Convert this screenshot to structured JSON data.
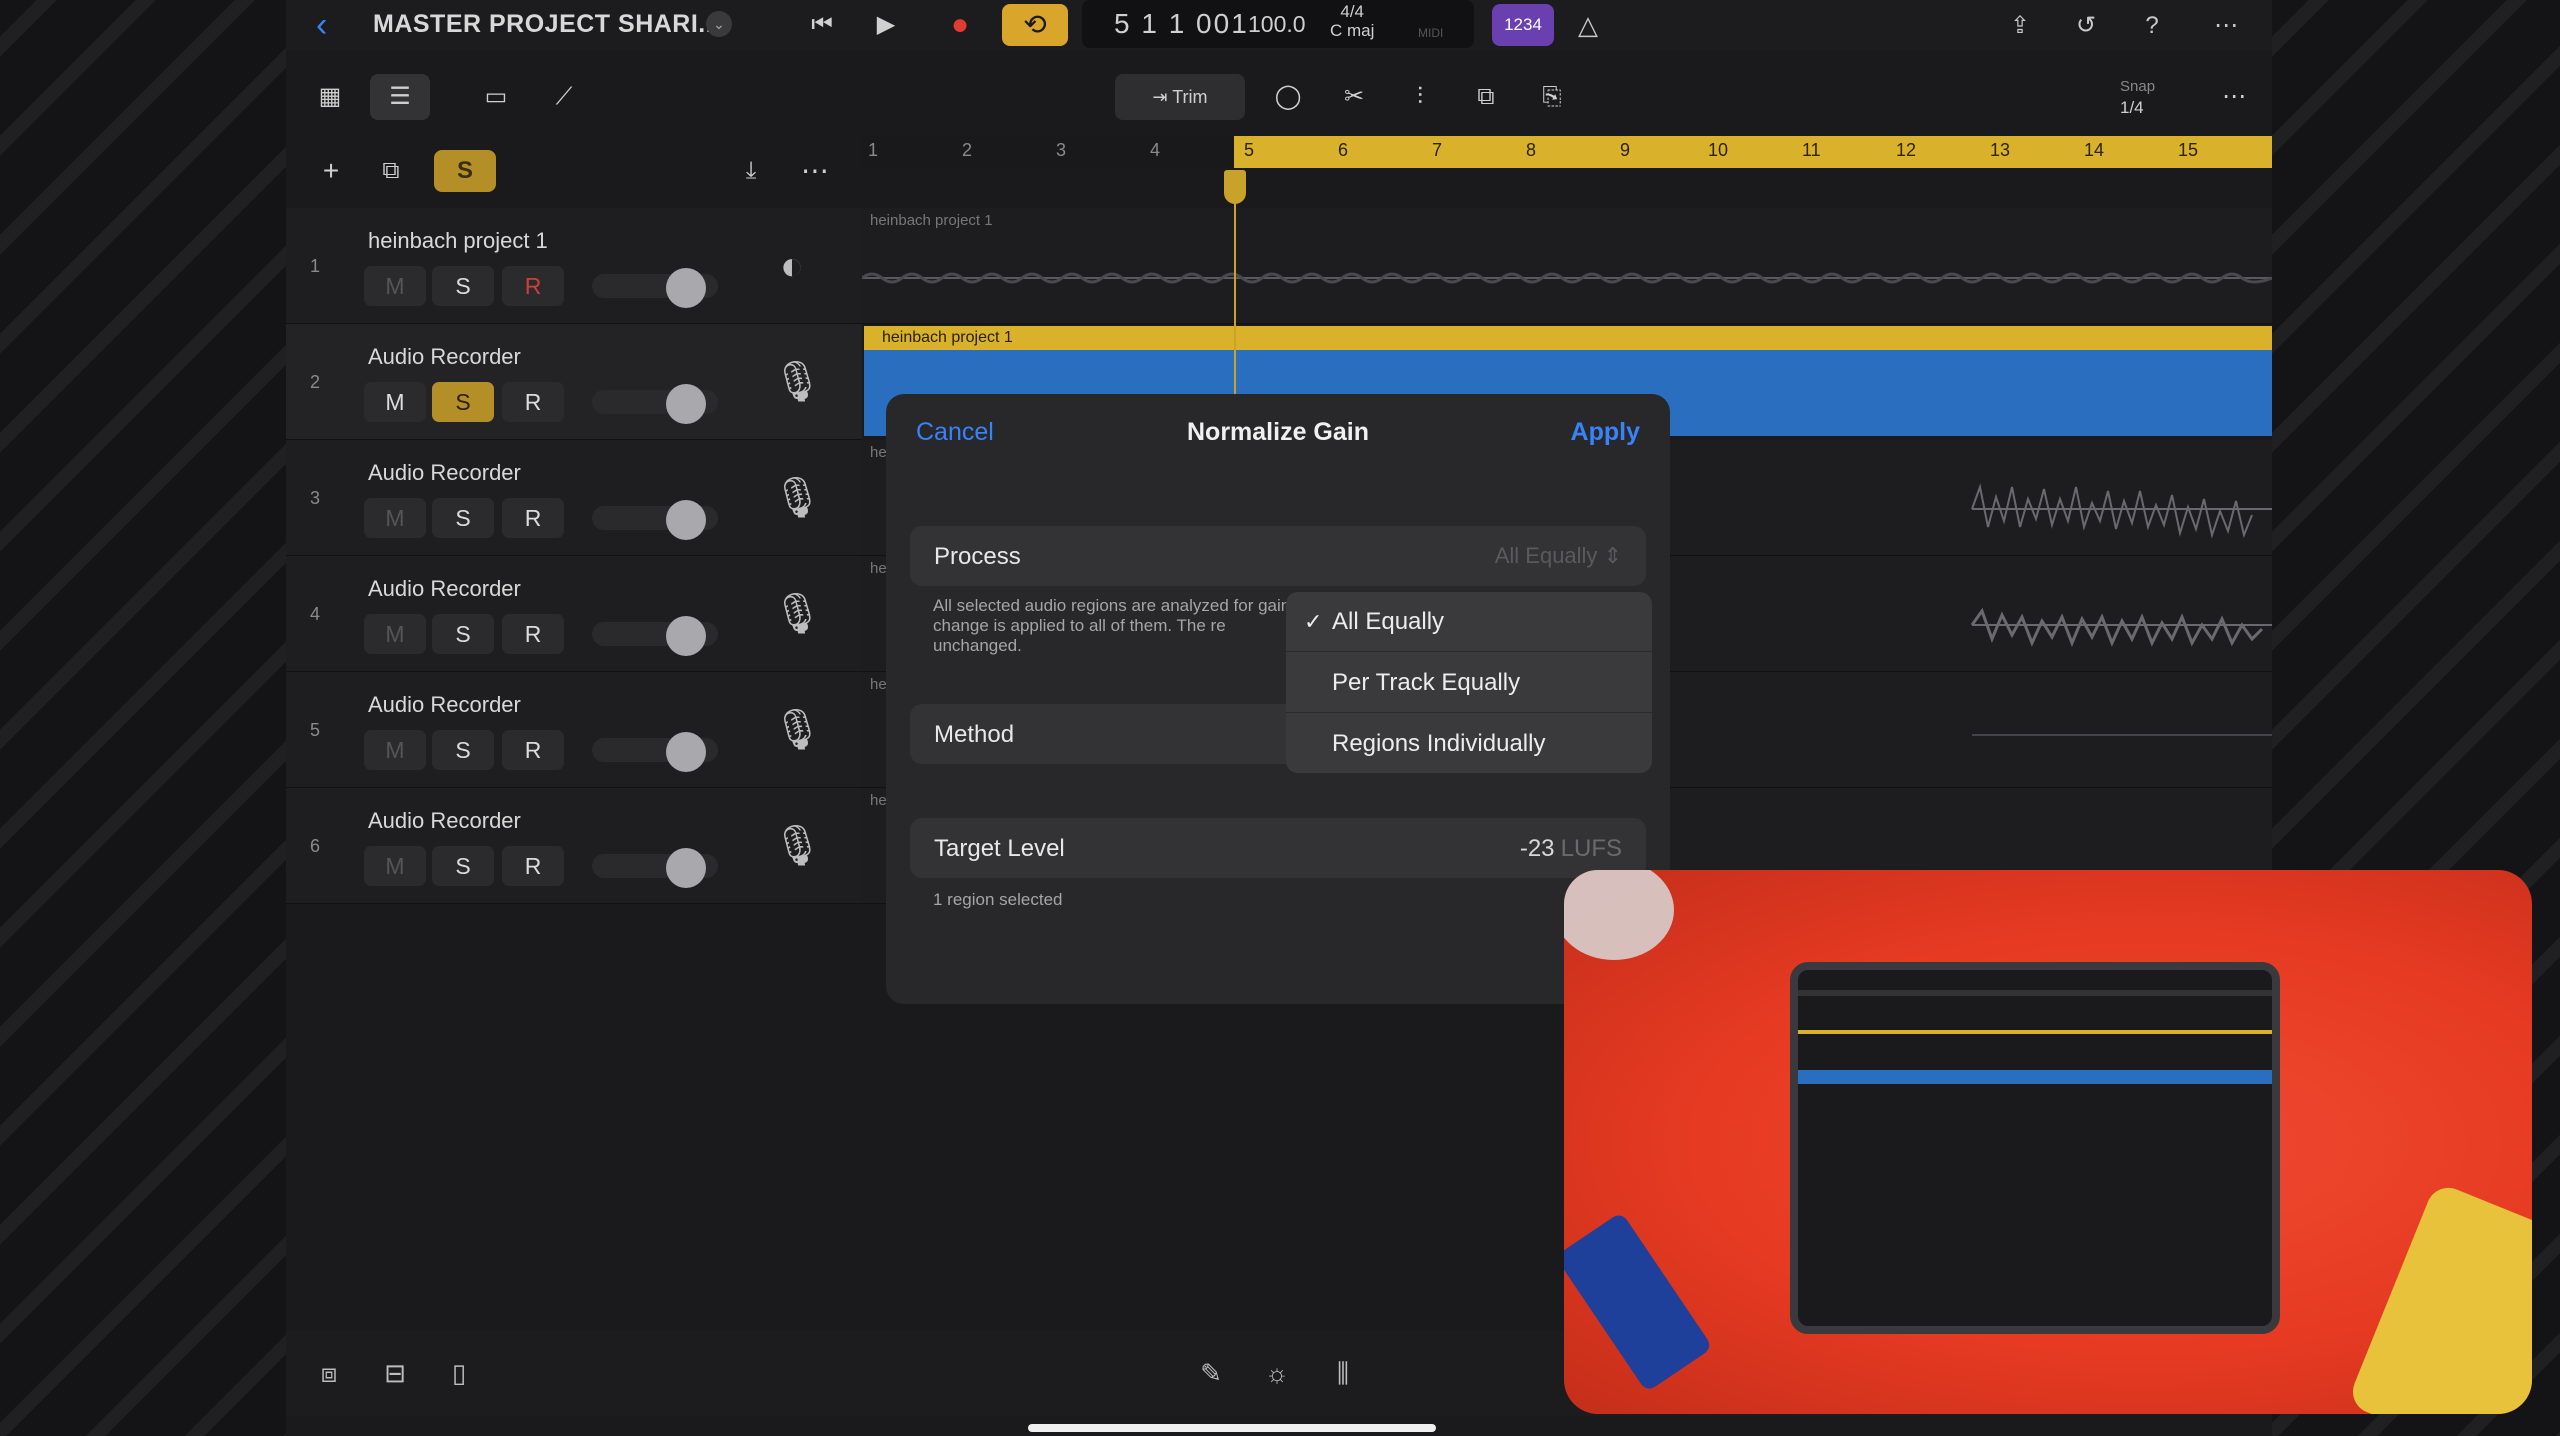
{
  "header": {
    "project_title": "MASTER PROJECT SHARI...",
    "position": "5 1 1 001",
    "tempo": "100.0",
    "time_signature": "4/4",
    "key": "C maj",
    "midi_label": "MIDI",
    "count_in": "1234"
  },
  "toolbar": {
    "trim_label": "Trim",
    "snap_label": "Snap",
    "snap_value": "1/4"
  },
  "track_header": {
    "solo_label": "S"
  },
  "ruler": {
    "bars": [
      "1",
      "2",
      "3",
      "4",
      "5",
      "6",
      "7",
      "8",
      "9",
      "10",
      "11",
      "12",
      "13",
      "14",
      "15"
    ]
  },
  "tracks": [
    {
      "number": "1",
      "name": "heinbach project 1",
      "m": "M",
      "s": "S",
      "r": "R"
    },
    {
      "number": "2",
      "name": "Audio Recorder",
      "m": "M",
      "s": "S",
      "r": "R"
    },
    {
      "number": "3",
      "name": "Audio Recorder",
      "m": "M",
      "s": "S",
      "r": "R"
    },
    {
      "number": "4",
      "name": "Audio Recorder",
      "m": "M",
      "s": "S",
      "r": "R"
    },
    {
      "number": "5",
      "name": "Audio Recorder",
      "m": "M",
      "s": "S",
      "r": "R"
    },
    {
      "number": "6",
      "name": "Audio Recorder",
      "m": "M",
      "s": "S",
      "r": "R"
    }
  ],
  "regions": {
    "track1": "heinbach project 1",
    "track2": "heinbach project 1",
    "track3": "he",
    "track4": "he",
    "track5": "he",
    "track6": "he"
  },
  "dialog": {
    "cancel": "Cancel",
    "title": "Normalize Gain",
    "apply": "Apply",
    "process_label": "Process",
    "process_value": "All Equally",
    "description": "All selected audio regions are analyzed for gain change is applied to all of them. The re unchanged.",
    "method_label": "Method",
    "target_label": "Target Level",
    "target_value": "-23",
    "target_unit": "LUFS",
    "footer": "1 region selected"
  },
  "process_menu": {
    "options": [
      "All Equally",
      "Per Track Equally",
      "Regions Individually"
    ],
    "selected": "All Equally"
  },
  "colors": {
    "accent": "#3a82f7",
    "cycle": "#d9b12b",
    "solo": "#b48f28",
    "record": "#e23b30",
    "region_blue": "#2a6fbf",
    "count_in": "#6a3fb0"
  }
}
